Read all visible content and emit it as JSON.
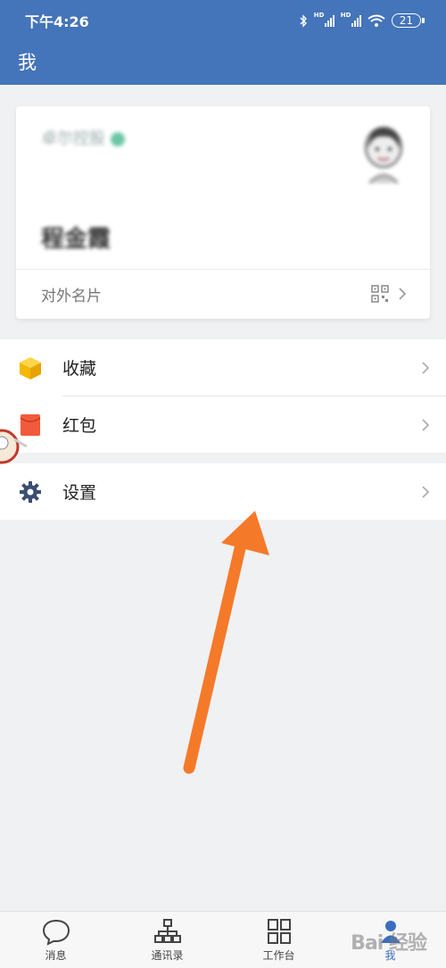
{
  "status_bar": {
    "time": "下午4:26",
    "battery": "21",
    "hd1": "HD",
    "hd2": "HD"
  },
  "header": {
    "title": "我"
  },
  "profile": {
    "company": "卓尔控股",
    "name": "程金霞",
    "card_label": "对外名片"
  },
  "menu": {
    "group1": [
      {
        "label": "收藏",
        "icon": "cube-icon"
      },
      {
        "label": "红包",
        "icon": "red-envelope-icon"
      }
    ],
    "group2": [
      {
        "label": "设置",
        "icon": "gear-icon"
      }
    ]
  },
  "bottom_nav": [
    {
      "label": "消息",
      "icon": "chat-bubble-icon",
      "active": false
    },
    {
      "label": "通讯录",
      "icon": "org-chart-icon",
      "active": false
    },
    {
      "label": "工作台",
      "icon": "grid-icon",
      "active": false
    },
    {
      "label": "我",
      "icon": "person-icon",
      "active": true
    }
  ],
  "watermark": "Bai 经验",
  "colors": {
    "header": "#4474b9",
    "accent": "#3a6fc0",
    "arrow": "#f47a2a",
    "background": "#f0f1f3"
  }
}
